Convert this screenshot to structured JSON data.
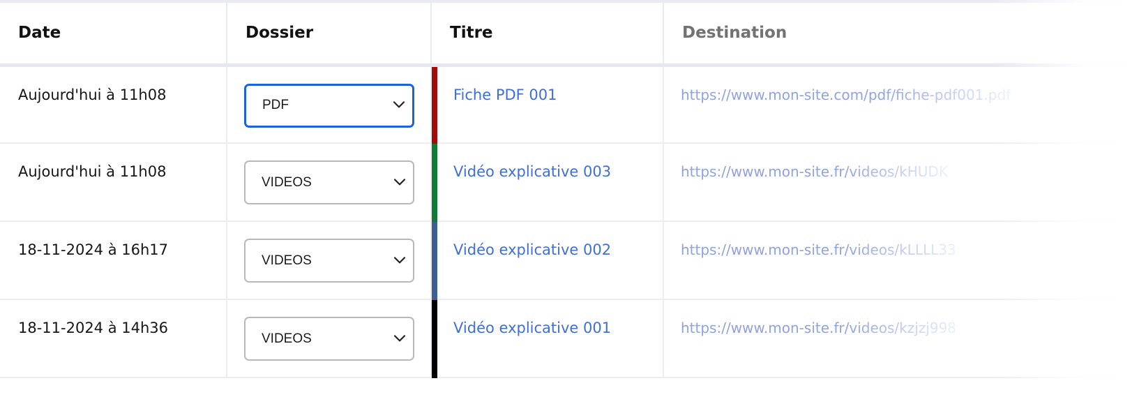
{
  "table": {
    "headers": {
      "date": "Date",
      "dossier": "Dossier",
      "titre": "Titre",
      "destination": "Destination"
    },
    "rows": [
      {
        "date": "Aujourd'hui à 11h08",
        "dossier": "PDF",
        "titre": "Fiche PDF 001",
        "destination": "https://www.mon-site.com/pdf/fiche-pdf001.pdf",
        "accent_color": "#a30a0a"
      },
      {
        "date": "Aujourd'hui à 11h08",
        "dossier": "VIDEOS",
        "titre": "Vidéo explicative 003",
        "destination": "https://www.mon-site.fr/videos/kHUDK",
        "accent_color": "#0e7a34"
      },
      {
        "date": "18-11-2024 à 16h17",
        "dossier": "VIDEOS",
        "titre": "Vidéo explicative 002",
        "destination": "https://www.mon-site.fr/videos/kLLLL33",
        "accent_color": "#3c5e92"
      },
      {
        "date": "18-11-2024 à 14h36",
        "dossier": "VIDEOS",
        "titre": "Vidéo explicative 001",
        "destination": "https://www.mon-site.fr/videos/kzjzj998",
        "accent_color": "#000000"
      }
    ]
  },
  "icons": {
    "select_chevron": "chevron-down-icon"
  },
  "colors": {
    "link": "#3f6fd6",
    "destination_link": "#8fa3e0",
    "focus_border": "#1a63d8"
  }
}
